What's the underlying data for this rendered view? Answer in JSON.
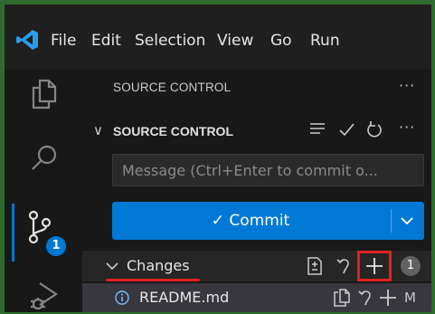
{
  "menu": [
    "File",
    "Edit",
    "Selection",
    "View",
    "Go",
    "Run"
  ],
  "sidebar": {
    "view_title": "SOURCE CONTROL",
    "section_title": "SOURCE CONTROL",
    "commit_placeholder": "Message (Ctrl+Enter to commit o...",
    "commit_label": "✓ Commit",
    "changes_label": "Changes",
    "changes_count": "1",
    "file": {
      "name": "README.md",
      "status": "M"
    }
  },
  "activity": {
    "scm_badge": "1"
  },
  "colors": {
    "accent": "#0078d4",
    "highlight": "#e02020"
  },
  "icons": [
    "vscode-logo",
    "explorer-icon",
    "search-icon",
    "source-control-icon",
    "run-debug-icon",
    "more-icon",
    "list-icon",
    "check-icon",
    "refresh-icon",
    "chevron-down-icon",
    "open-changes-icon",
    "discard-icon",
    "stage-icon",
    "info-icon",
    "open-file-icon"
  ]
}
